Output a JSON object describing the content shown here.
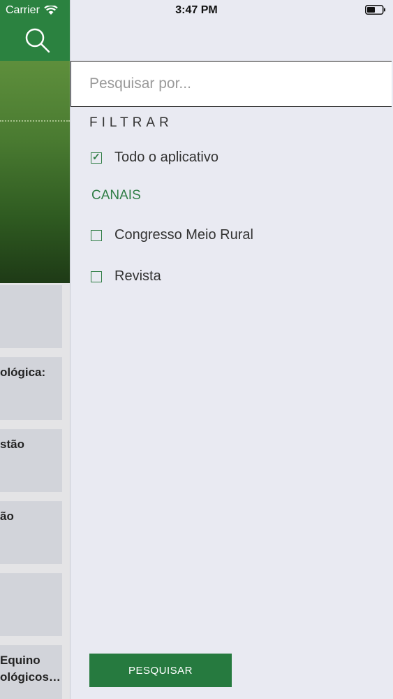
{
  "status_bar": {
    "carrier": "Carrier",
    "time": "3:47 PM"
  },
  "background_app": {
    "header_color": "#2b8240",
    "cards": [
      {
        "text_line1": "",
        "text_line2": ""
      },
      {
        "text_line1": "ológica:",
        "text_line2": ""
      },
      {
        "text_line1": "stão",
        "text_line2": ""
      },
      {
        "text_line1": "ão",
        "text_line2": ""
      },
      {
        "text_line1": "",
        "text_line2": ""
      },
      {
        "text_line1": "Equino",
        "text_line2": "ológicos…"
      }
    ]
  },
  "search": {
    "placeholder": "Pesquisar por...",
    "value": ""
  },
  "filter": {
    "heading": "FILTRAR",
    "all_app_label": "Todo o aplicativo",
    "all_app_checked": true,
    "channels_heading": "CANAIS",
    "channels": [
      {
        "label": "Congresso Meio Rural",
        "checked": false
      },
      {
        "label": "Revista",
        "checked": false
      }
    ]
  },
  "actions": {
    "search_button": "PESQUISAR"
  },
  "colors": {
    "accent": "#2f7d45",
    "button": "#267a3f",
    "panel_bg": "#e9eaf2"
  }
}
